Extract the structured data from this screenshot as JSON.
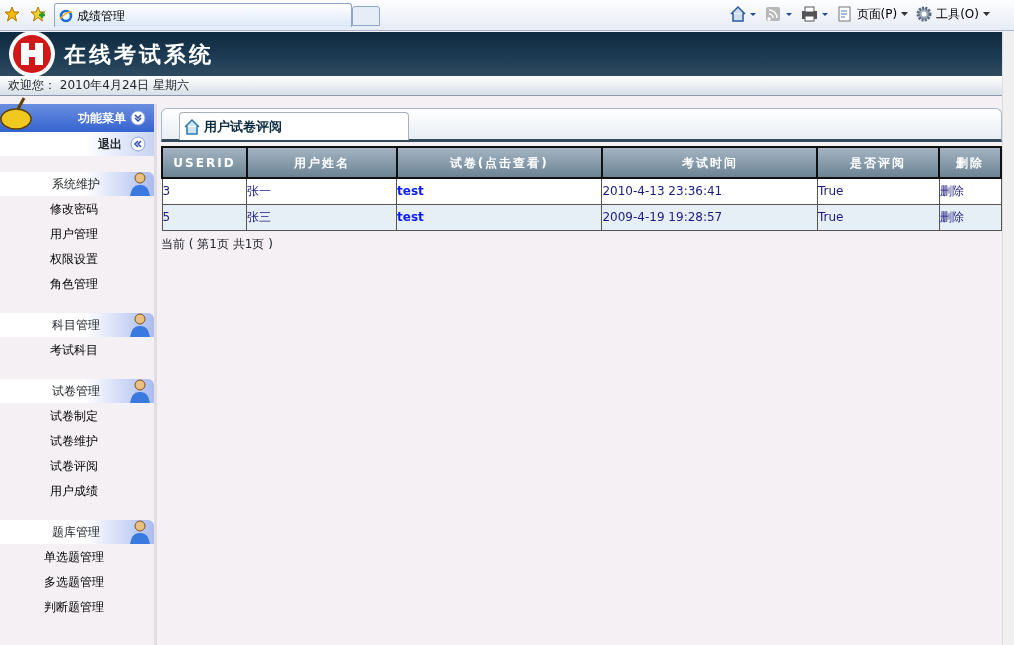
{
  "browser": {
    "tab_title": "成绩管理",
    "page_menu": "页面(P)",
    "tools_menu": "工具(O)"
  },
  "header": {
    "title": "在线考试系统",
    "welcome": "欢迎您： 2010年4月24日  星期六"
  },
  "sidebar": {
    "menu_title": "功能菜单",
    "logout": "退出",
    "groups": [
      {
        "title": "系统维护",
        "items": [
          "修改密码",
          "用户管理",
          "权限设置",
          "角色管理"
        ]
      },
      {
        "title": "科目管理",
        "items": [
          "考试科目"
        ]
      },
      {
        "title": "试卷管理",
        "items": [
          "试卷制定",
          "试卷维护",
          "试卷评阅",
          "用户成绩"
        ]
      },
      {
        "title": "题库管理",
        "items": [
          "单选题管理",
          "多选题管理",
          "判断题管理"
        ]
      }
    ]
  },
  "content": {
    "tab": "用户试卷评阅",
    "table": {
      "columns": [
        "USERID",
        "用户姓名",
        "试卷(点击查看)",
        "考试时间",
        "是否评阅",
        "删除"
      ],
      "rows": [
        [
          "3",
          "张一",
          "test",
          "2010-4-13 23:36:41",
          "True",
          "删除"
        ],
        [
          "5",
          "张三",
          "test",
          "2009-4-19 19:28:57",
          "True",
          "删除"
        ]
      ]
    },
    "pager": "当前 ( 第1页  共1页 )"
  }
}
